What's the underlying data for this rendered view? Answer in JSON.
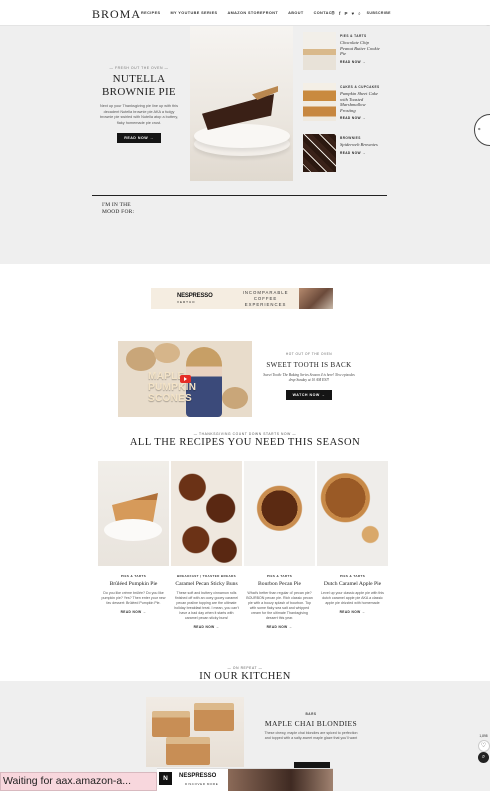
{
  "header": {
    "logo": "BROMA",
    "nav": [
      "RECIPES",
      "MY YOUTUBE SERIES",
      "AMAZON STOREFRONT",
      "ABOUT",
      "CONTACT"
    ],
    "icons": [
      "instagram-icon",
      "facebook-icon",
      "pinterest-icon",
      "twitter-icon",
      "search-icon"
    ],
    "subscribe": "SUBSCRIBE"
  },
  "hero": {
    "kicker": "— FRESH OUT THE OVEN —",
    "title": "NUTELLA BROWNIE PIE",
    "description": "Next up your Thanksgiving pie line up with this decadent Nutella brownie pie AKA a fudgy brownie pie swirled with Nutella atop a buttery, flaky homemade pie crust.",
    "button": "READ NOW →",
    "side": [
      {
        "category": "PIES & TARTS",
        "title": "Chocolate Chip Peanut Butter Cookie Pie",
        "read": "READ NOW →"
      },
      {
        "category": "CAKES & CUPCAKES",
        "title": "Pumpkin Sheet Cake with Toasted Marshmallow Frosting",
        "read": "READ NOW →"
      },
      {
        "category": "BROWNIES",
        "title": "Spiderweb Brownies",
        "read": "READ NOW →"
      }
    ],
    "mood_label": "I'M IN THE MOOD FOR:"
  },
  "ad_banner": {
    "brand": "NESPRESSO",
    "sub": "VERTUO",
    "tagline": "INCOMPARABLE COFFEE EXPERIENCES"
  },
  "youtube": {
    "overlay": "MAPLE PUMPKIN SCONES",
    "kicker": "HOT OUT OF THE OVEN",
    "title": "SWEET TOOTH IS BACK",
    "description": "Sweet Tooth: The Baking Series Season 4 is here! New episodes drop Sunday at 10 AM EST!",
    "button": "WATCH NOW →"
  },
  "season": {
    "kicker": "— THANKSGIVING COUNT DOWN STARTS NOW —",
    "title": "ALL THE RECIPES YOU NEED THIS SEASON",
    "recipes": [
      {
        "category": "PIES & TARTS",
        "title": "Brûléed Pumpkin Pie",
        "description": "Do you like crème brûlée? Do you like pumpkin pie? Yes? Then enter your new fav dessert: Brûléed Pumpkin Pie.",
        "read": "READ NOW →"
      },
      {
        "category": "BREAKFAST | TOASTED BREADS",
        "title": "Caramel Pecan Sticky Buns",
        "description": "These soft and buttery cinnamon rolls finished off with an ooey gooey caramel pecan praline topping are the ultimate holiday breakfast treat. I mean, you can't have a bad day when it starts with caramel pecan sticky buns!",
        "read": "READ NOW →"
      },
      {
        "category": "PIES & TARTS",
        "title": "Bourbon Pecan Pie",
        "description": "What's better than regular ol' pecan pie? BOURBON pecan pie. Rich classic pecan pie with a boozy splash of bourbon. Top with some flaky sea salt and whipped cream for the ultimate Thanksgiving dessert this year.",
        "read": "READ NOW →"
      },
      {
        "category": "PIES & TARTS",
        "title": "Dutch Caramel Apple Pie",
        "description": "Level up your classic apple pie with this dutch caramel apple pie AKA a classic apple pie drizzled with homemade",
        "read": "READ NOW →"
      }
    ]
  },
  "kitchen": {
    "kicker": "— ON REPEAT —",
    "title": "IN OUR KITCHEN",
    "feature": {
      "category": "BARS",
      "title": "MAPLE CHAI BLONDIES",
      "description": "These chewy, maple chai blondies are spiced to perfection and topped with a salty-sweet maple glaze that you'll want"
    }
  },
  "bottom_ad": {
    "brand": "NESPRESSO",
    "cta": "DISCOVER MORE"
  },
  "status": "Waiting for aax.amazon-a...",
  "save_widget": {
    "count": "1,898"
  },
  "colors": {
    "accent": "#151515",
    "background_band": "#efefef",
    "status_bar": "#f8d7dd",
    "youtube_red": "#e52d27"
  }
}
